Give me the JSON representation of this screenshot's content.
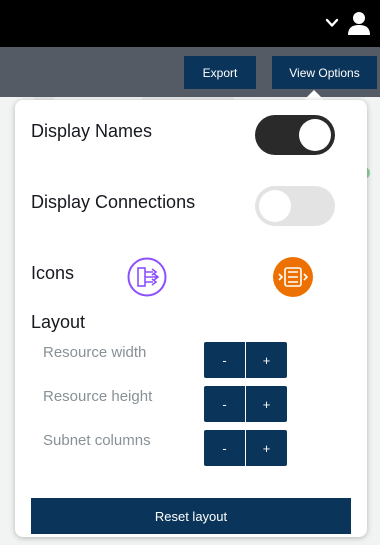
{
  "topbar": {
    "dropdown_icon": "chevron-down-icon",
    "account_icon": "user-icon"
  },
  "toolbar": {
    "export_label": "Export",
    "view_options_label": "View Options"
  },
  "panel": {
    "display_names": {
      "label": "Display Names",
      "enabled": true
    },
    "display_connections": {
      "label": "Display Connections",
      "enabled": false
    },
    "icons": {
      "label": "Icons",
      "options": [
        {
          "icon": "nat-gateway-icon",
          "color": "#8c4fff",
          "style": "outline",
          "selected": true
        },
        {
          "icon": "load-balancer-icon",
          "color": "#ed7100",
          "style": "filled",
          "selected": false
        }
      ]
    },
    "layout": {
      "heading": "Layout",
      "rows": [
        {
          "label": "Resource width",
          "minus": "-",
          "plus": "+"
        },
        {
          "label": "Resource height",
          "minus": "-",
          "plus": "+"
        },
        {
          "label": "Subnet columns",
          "minus": "-",
          "plus": "+"
        }
      ]
    },
    "reset_label": "Reset layout"
  },
  "colors": {
    "topbar": "#000000",
    "toolbar": "#545b64",
    "primary_button": "#0a3459",
    "toggle_on": "#2a2a2a",
    "toggle_off": "#e3e3e3"
  }
}
